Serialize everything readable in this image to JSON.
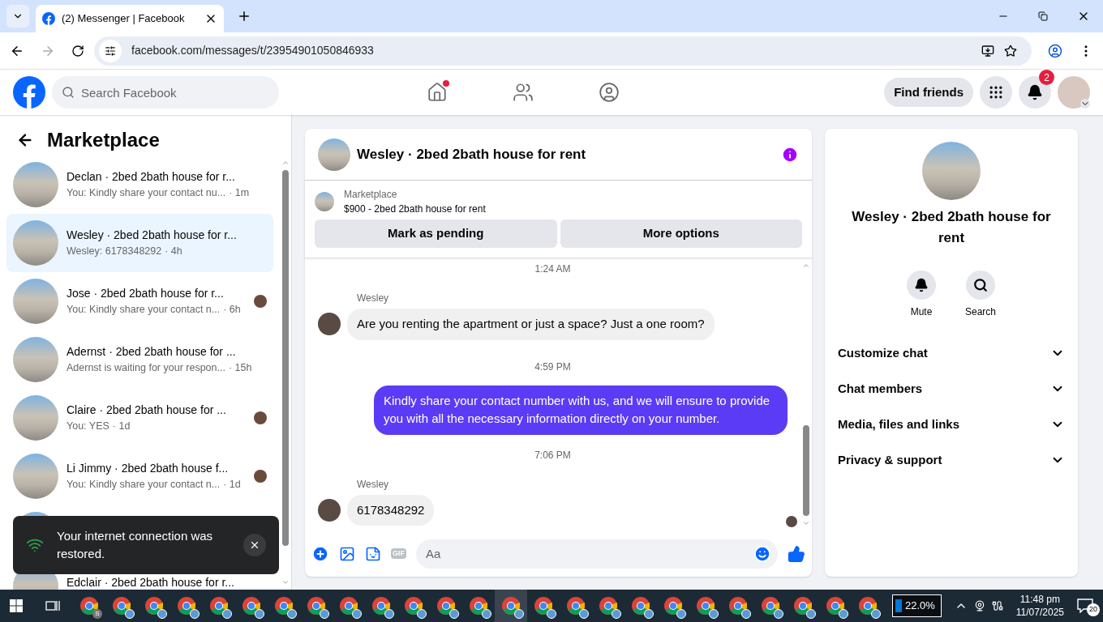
{
  "browser": {
    "tab_title": "(2) Messenger | Facebook",
    "url": "facebook.com/messages/t/23954901050846933"
  },
  "header": {
    "search_placeholder": "Search Facebook",
    "home_dot": true,
    "find_friends": "Find friends",
    "notification_count": "2"
  },
  "sidebar": {
    "title": "Marketplace",
    "conversations": [
      {
        "name": "Declan · 2bed 2bath house for r...",
        "preview": "You: Kindly share your contact nu...",
        "time": "· 1m",
        "selected": false,
        "seen": false
      },
      {
        "name": "Wesley · 2bed 2bath house for r...",
        "preview": "Wesley: 6178348292",
        "time": "· 4h",
        "selected": true,
        "seen": false
      },
      {
        "name": "Jose · 2bed 2bath house for r...",
        "preview": "You: Kindly share your contact n...",
        "time": "· 6h",
        "selected": false,
        "seen": true
      },
      {
        "name": "Adernst · 2bed 2bath house for ...",
        "preview": "Adernst is waiting for your respon...",
        "time": "· 15h",
        "selected": false,
        "seen": false
      },
      {
        "name": "Claire · 2bed 2bath house for ...",
        "preview": "You: YES",
        "time": "· 1d",
        "selected": false,
        "seen": true
      },
      {
        "name": "Li Jimmy · 2bed 2bath house f...",
        "preview": "You: Kindly share your contact n...",
        "time": "· 1d",
        "selected": false,
        "seen": true
      }
    ],
    "toast": "Your internet connection was restored.",
    "last_conversation": "Edclair · 2bed 2bath house for r..."
  },
  "chat": {
    "title": "Wesley · 2bed 2bath house for rent",
    "listing_source": "Marketplace",
    "listing_title": "$900 - 2bed 2bath house for rent",
    "buttons": [
      "Mark as pending",
      "More options"
    ],
    "messages": [
      {
        "kind": "time",
        "text": "1:24 AM"
      },
      {
        "kind": "incoming",
        "sender": "Wesley",
        "text": "Are you renting the apartment or just a space? Just a one room?"
      },
      {
        "kind": "time",
        "text": "4:59 PM"
      },
      {
        "kind": "outgoing",
        "text": "Kindly share your contact number with us, and we will ensure to provide you with all the necessary information directly on your number."
      },
      {
        "kind": "time",
        "text": "7:06 PM"
      },
      {
        "kind": "incoming",
        "sender": "Wesley",
        "text": "6178348292"
      }
    ],
    "gif_label": "GIF",
    "input_placeholder": "Aa"
  },
  "details": {
    "name": "Wesley · 2bed 2bath house for rent",
    "actions": [
      {
        "kind": "mute",
        "label": "Mute"
      },
      {
        "kind": "search",
        "label": "Search"
      }
    ],
    "sections": [
      "Customize chat",
      "Chat members",
      "Media, files and links",
      "Privacy & support"
    ]
  },
  "taskbar": {
    "apps": [
      {
        "kind": "letter",
        "badge": "S",
        "selected": false
      },
      {
        "kind": "profile",
        "selected": false
      },
      {
        "kind": "profile",
        "selected": false
      },
      {
        "kind": "profile",
        "selected": false
      },
      {
        "kind": "profile",
        "selected": false
      },
      {
        "kind": "profile",
        "selected": false
      },
      {
        "kind": "profile",
        "selected": false
      },
      {
        "kind": "profile",
        "selected": false
      },
      {
        "kind": "profile",
        "selected": false
      },
      {
        "kind": "profile",
        "selected": false
      },
      {
        "kind": "profile",
        "selected": false
      },
      {
        "kind": "profile",
        "selected": false
      },
      {
        "kind": "profile",
        "selected": false
      },
      {
        "kind": "profile",
        "selected": true
      },
      {
        "kind": "profile",
        "selected": false
      },
      {
        "kind": "profile",
        "selected": false
      },
      {
        "kind": "profile",
        "selected": false
      },
      {
        "kind": "profile",
        "selected": false
      },
      {
        "kind": "profile",
        "selected": false
      },
      {
        "kind": "profile",
        "selected": false
      },
      {
        "kind": "profile",
        "selected": false
      },
      {
        "kind": "profile",
        "selected": false
      },
      {
        "kind": "profile",
        "selected": false
      },
      {
        "kind": "profile",
        "selected": false
      },
      {
        "kind": "profile",
        "selected": false
      }
    ],
    "battery": "22.0%",
    "time": "11:48 pm",
    "date": "11/07/2025",
    "notifications": "20"
  }
}
